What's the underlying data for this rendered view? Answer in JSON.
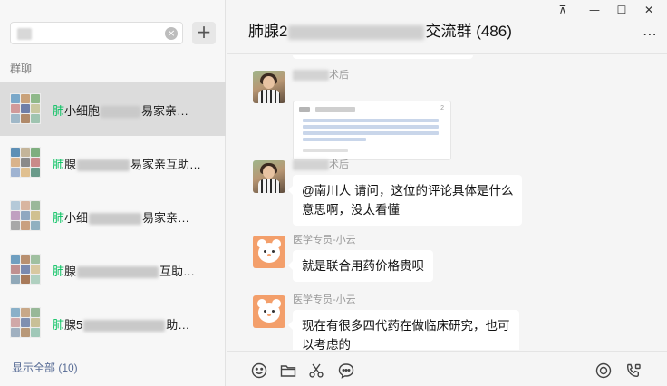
{
  "sidebar": {
    "search": {
      "value": "",
      "placeholder": ""
    },
    "clear_icon": "×",
    "add_icon": "+",
    "section_label": "群聊",
    "conversations": [
      {
        "prefix": "肺",
        "visible_a": "小细胞",
        "visible_b": "易家亲…",
        "selected": true
      },
      {
        "prefix": "肺",
        "visible_a": "腺",
        "visible_b": "易家亲互助…",
        "selected": false
      },
      {
        "prefix": "肺",
        "visible_a": "小细",
        "visible_b": "易家亲…",
        "selected": false
      },
      {
        "prefix": "肺",
        "visible_a": "腺",
        "visible_b": "互助…",
        "selected": false
      },
      {
        "prefix": "肺",
        "visible_a": "腺5",
        "visible_b": "助…",
        "selected": false
      }
    ],
    "show_all": "显示全部 (10)"
  },
  "header": {
    "title_prefix": "肺腺2",
    "title_suffix": "交流群 (486)",
    "pin_icon": "⊼",
    "minimize_icon": "—",
    "maximize_icon": "☐",
    "close_icon": "✕",
    "more_icon": "⋯"
  },
  "messages": [
    {
      "sender_suffix": "术后",
      "avatar": "photo",
      "type": "card",
      "card_count": "2"
    },
    {
      "sender_suffix": "术后",
      "avatar": "photo",
      "type": "text",
      "lines": [
        "@南川人 请问，这位的评论具体是什么",
        "意思啊，没太看懂"
      ]
    },
    {
      "sender": "医学专员-小云",
      "avatar": "bear",
      "type": "text",
      "lines": [
        "就是联合用药价格贵呗"
      ]
    },
    {
      "sender": "医学专员-小云",
      "avatar": "bear",
      "type": "text",
      "lines": [
        "现在有很多四代药在做临床研究，也可",
        "以考虑的"
      ]
    }
  ],
  "toolbar": {
    "left_icons": [
      "emoji-icon",
      "folder-icon",
      "scissors-icon",
      "chat-bubble-icon"
    ],
    "right_icons": [
      "live-icon",
      "video-call-icon"
    ]
  },
  "colors": {
    "accent_green": "#07c160",
    "link_blue": "#576b95",
    "bear_orange": "#f39f6b",
    "selected_bg": "#dcdcdc"
  }
}
